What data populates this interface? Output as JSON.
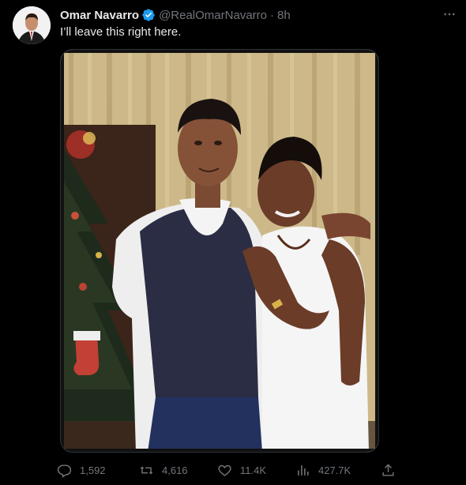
{
  "author": {
    "display_name": "Omar Navarro",
    "handle": "@RealOmarNavarro",
    "separator": "·",
    "time": "8h",
    "verified": true,
    "verified_color": "#1d9bf0"
  },
  "tweet": {
    "text": "I’ll leave this right here."
  },
  "media": {
    "type": "photo",
    "icon": "photo-icon"
  },
  "actions": {
    "replies": "1,592",
    "retweets": "4,616",
    "likes": "11.4K",
    "views": "427.7K"
  },
  "colors": {
    "background": "#000000",
    "text_primary": "#e7e9ea",
    "text_secondary": "#71767b",
    "border": "#2f3336"
  }
}
